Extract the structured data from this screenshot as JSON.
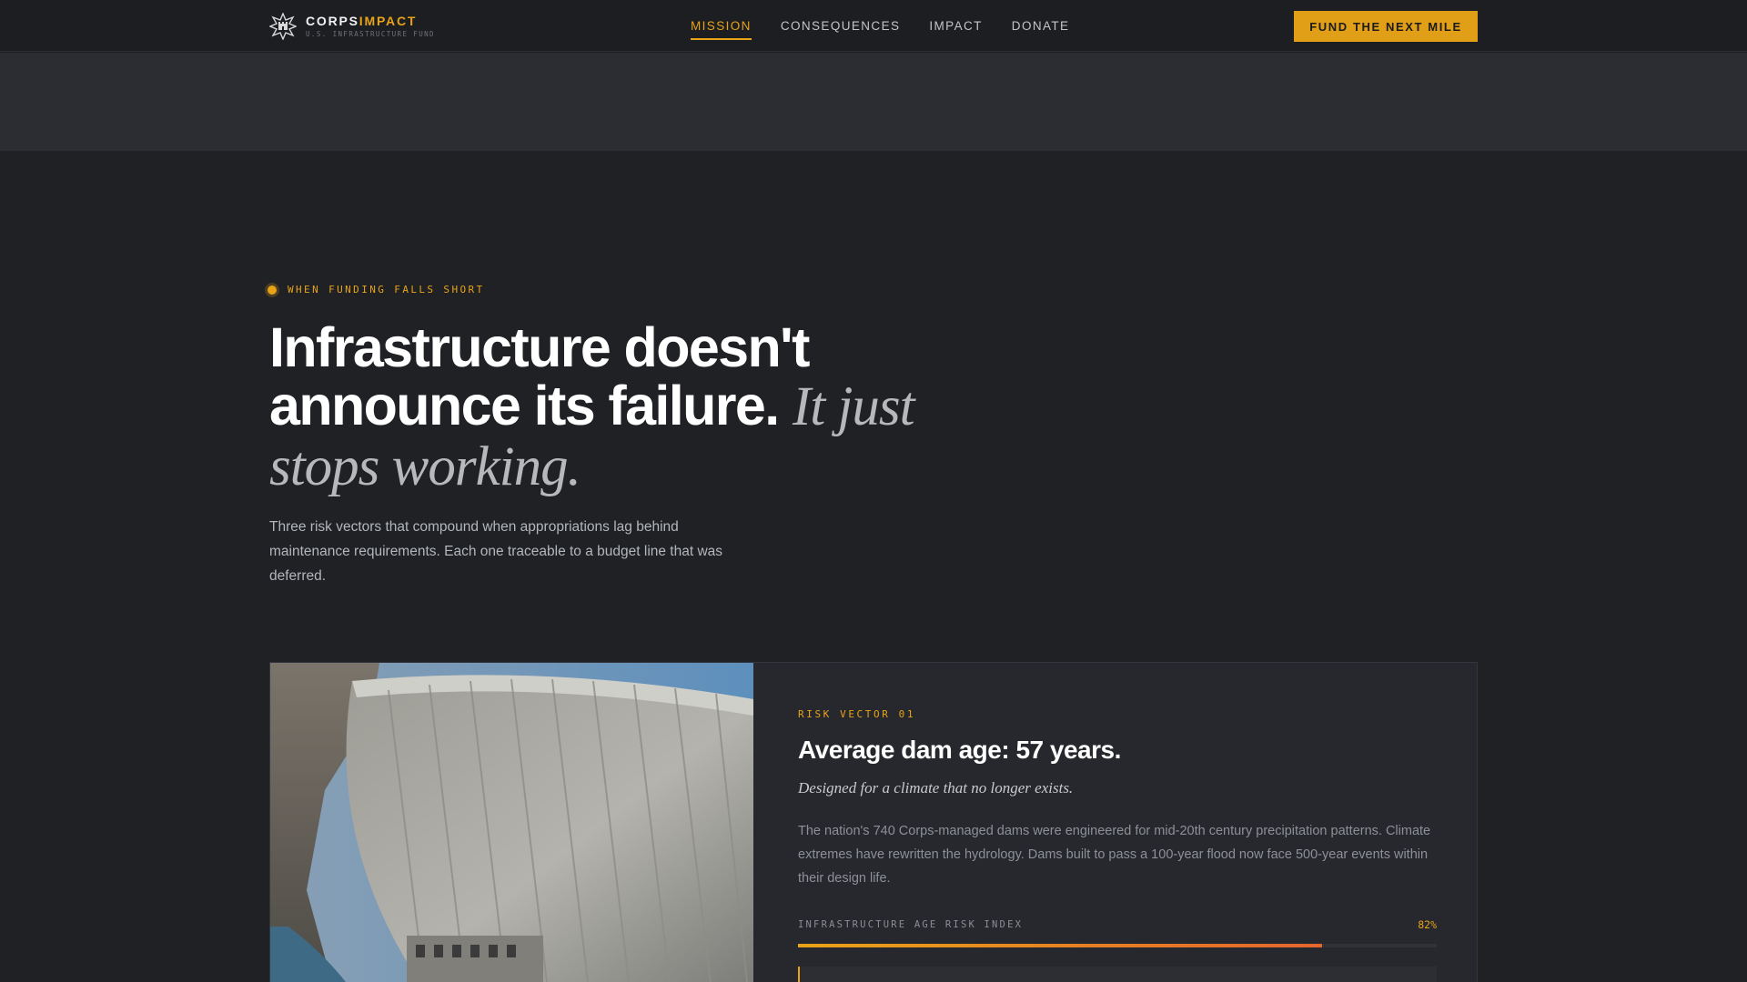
{
  "brand": {
    "name_primary": "CORPS",
    "name_accent": "IMPACT",
    "subtitle": "U.S. INFRASTRUCTURE FUND",
    "accent_color": "#e8a317"
  },
  "nav": {
    "items": [
      {
        "label": "MISSION",
        "active": true
      },
      {
        "label": "CONSEQUENCES",
        "active": false
      },
      {
        "label": "IMPACT",
        "active": false
      },
      {
        "label": "DONATE",
        "active": false
      }
    ],
    "cta_label": "FUND THE NEXT MILE"
  },
  "hero": {
    "eyebrow": "WHEN FUNDING FALLS SHORT",
    "title_plain": "Infrastructure doesn't announce its failure.",
    "title_italic": "It just stops working.",
    "description": "Three risk vectors that compound when appropriations lag behind maintenance requirements. Each one traceable to a budget line that was deferred."
  },
  "risk_card": {
    "image_icon": "concrete-dam-photo",
    "label": "RISK VECTOR 01",
    "title": "Average dam age: 57 years.",
    "subtitle": "Designed for a climate that no longer exists.",
    "body": "The nation's 740 Corps-managed dams were engineered for mid-20th century precipitation patterns. Climate extremes have rewritten the hydrology. Dams built to pass a 100-year flood now face 500-year events within their design life.",
    "meter_label": "INFRASTRUCTURE AGE RISK INDEX",
    "meter_value_text": "82%",
    "meter_fraction": 0.82
  }
}
